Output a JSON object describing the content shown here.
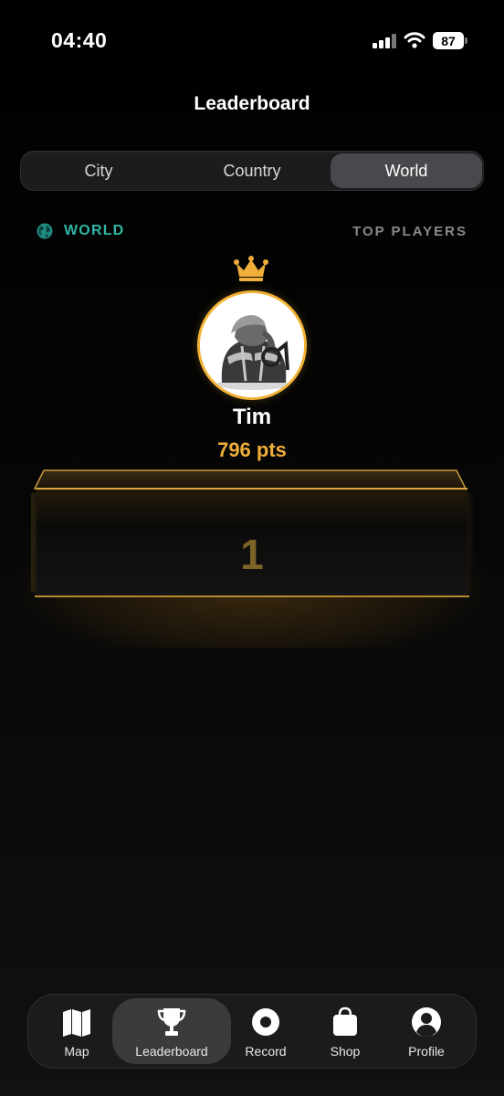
{
  "status_bar": {
    "time": "04:40",
    "battery": "87",
    "icons": [
      "signal-icon",
      "wifi-icon",
      "battery-icon"
    ]
  },
  "header": {
    "title": "Leaderboard"
  },
  "segments": [
    {
      "label": "City",
      "active": false
    },
    {
      "label": "Country",
      "active": false
    },
    {
      "label": "World",
      "active": true
    }
  ],
  "section": {
    "icon": "globe-icon",
    "title": "WORLD",
    "right_label": "TOP PLAYERS"
  },
  "leader": {
    "icon": "crown-icon",
    "name": "Tim",
    "points": "796 pts",
    "rank": "1"
  },
  "tab_bar": {
    "items": [
      {
        "label": "Map",
        "icon": "map-icon",
        "active": false
      },
      {
        "label": "Leaderboard",
        "icon": "trophy-icon",
        "active": true
      },
      {
        "label": "Record",
        "icon": "record-icon",
        "active": false
      },
      {
        "label": "Shop",
        "icon": "shopping-bag-icon",
        "active": false
      },
      {
        "label": "Profile",
        "icon": "profile-icon",
        "active": false
      }
    ]
  },
  "colors": {
    "accent_gold": "#f0ae3a",
    "accent_teal": "#2fb5a5",
    "background": "#000000",
    "segment_active": "#48494c"
  }
}
